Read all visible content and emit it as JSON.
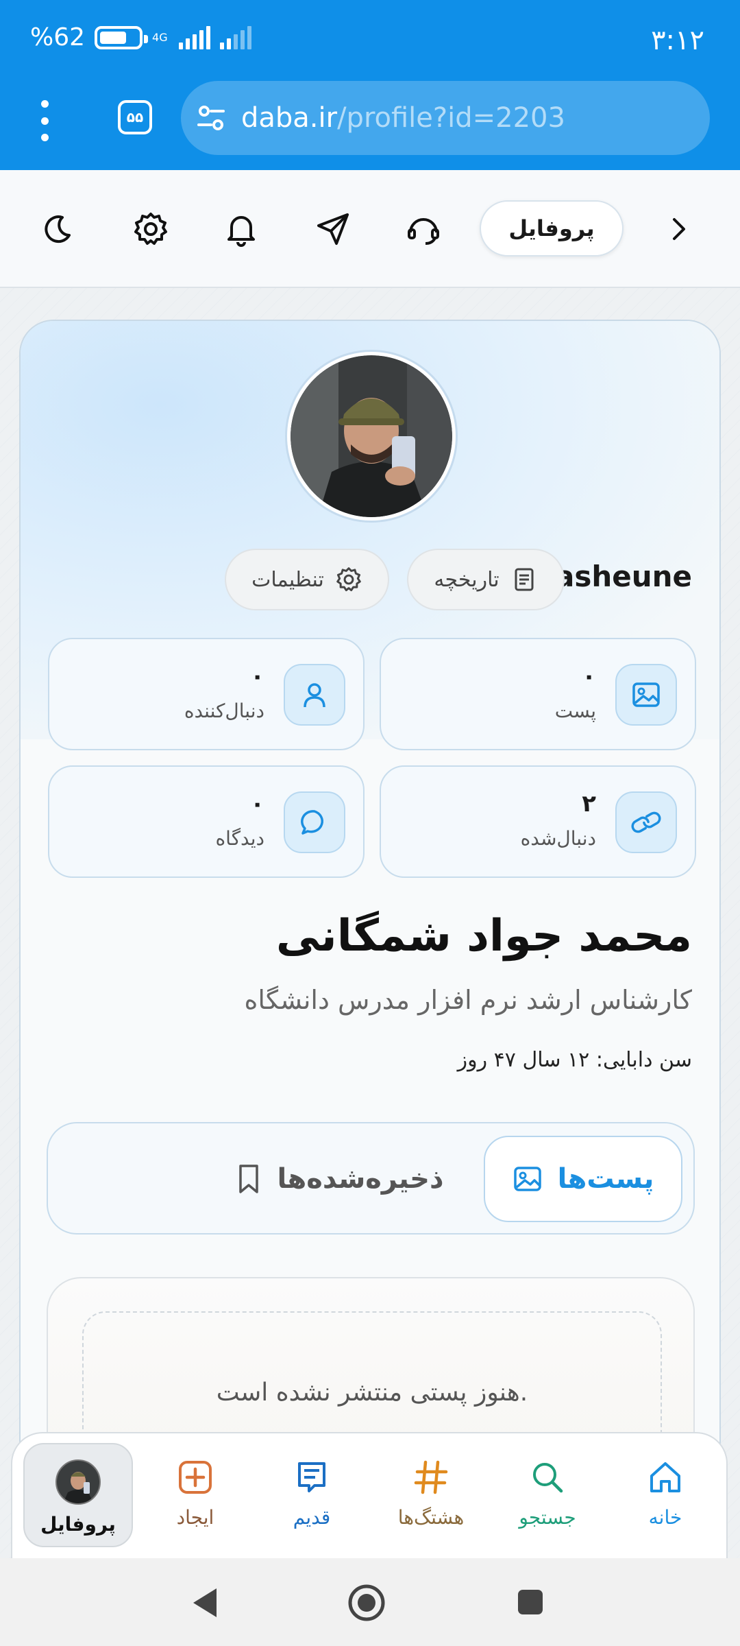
{
  "status_bar": {
    "time": "۳:۱۲",
    "battery_text": "%62",
    "battery_level": 0.62,
    "network": "4G"
  },
  "browser": {
    "tab_count": "۵۵",
    "url_host": "daba.ir",
    "url_path": "/profile?id=2203"
  },
  "toolbar": {
    "page_title": "پروفایل",
    "icons": [
      "chevron-right-icon",
      "headset-icon",
      "send-icon",
      "bell-icon",
      "gear-icon",
      "moon-icon"
    ]
  },
  "profile": {
    "username": "asheune",
    "history_label": "تاریخچه",
    "settings_label": "تنظیمات",
    "stats": {
      "posts": {
        "value": "۰",
        "label": "پست"
      },
      "followers": {
        "value": "۰",
        "label": "دنبال‌کننده"
      },
      "following": {
        "value": "۲",
        "label": "دنبال‌شده"
      },
      "comments": {
        "value": "۰",
        "label": "دیدگاه"
      }
    },
    "full_name": "محمد جواد شمگانی",
    "bio": "کارشناس ارشد نرم افزار مدرس دانشگاه",
    "age_text": "سن دابایی: ۱۲ سال ۴۷ روز"
  },
  "content_tabs": {
    "posts": "پست‌ها",
    "saved": "ذخیره‌شده‌ها"
  },
  "empty_state": "هنوز پستی منتشر نشده است.",
  "bottom_nav": {
    "home": "خانه",
    "search": "جستجو",
    "hashtags": "هشتگ‌ها",
    "old": "قدیم",
    "create": "ایجاد",
    "profile": "پروفایل"
  },
  "colors": {
    "brand_blue": "#0f8fe8",
    "accent_blue": "#1b8fe0",
    "hashtag_orange": "#e08a1e",
    "search_green": "#1e9e7a",
    "create_orange": "#d9733a"
  }
}
